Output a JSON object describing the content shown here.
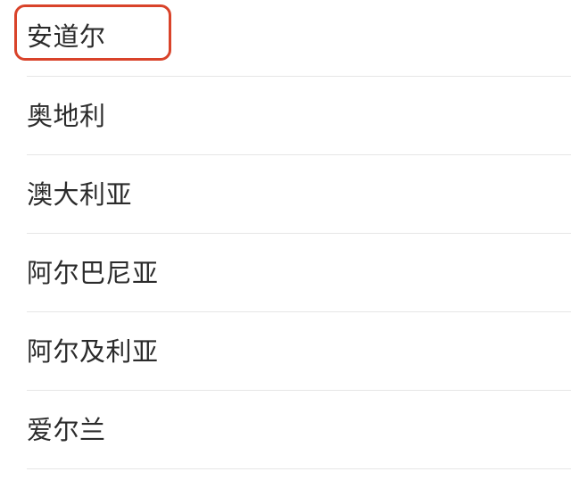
{
  "country_list": {
    "items": [
      {
        "label": "安道尔",
        "highlighted": true
      },
      {
        "label": "奥地利",
        "highlighted": false
      },
      {
        "label": "澳大利亚",
        "highlighted": false
      },
      {
        "label": "阿尔巴尼亚",
        "highlighted": false
      },
      {
        "label": "阿尔及利亚",
        "highlighted": false
      },
      {
        "label": "爱尔兰",
        "highlighted": false
      }
    ]
  },
  "colors": {
    "highlight_border": "#d9432a",
    "divider": "#e6e6e6",
    "text": "#2b2b2b",
    "background": "#ffffff"
  }
}
